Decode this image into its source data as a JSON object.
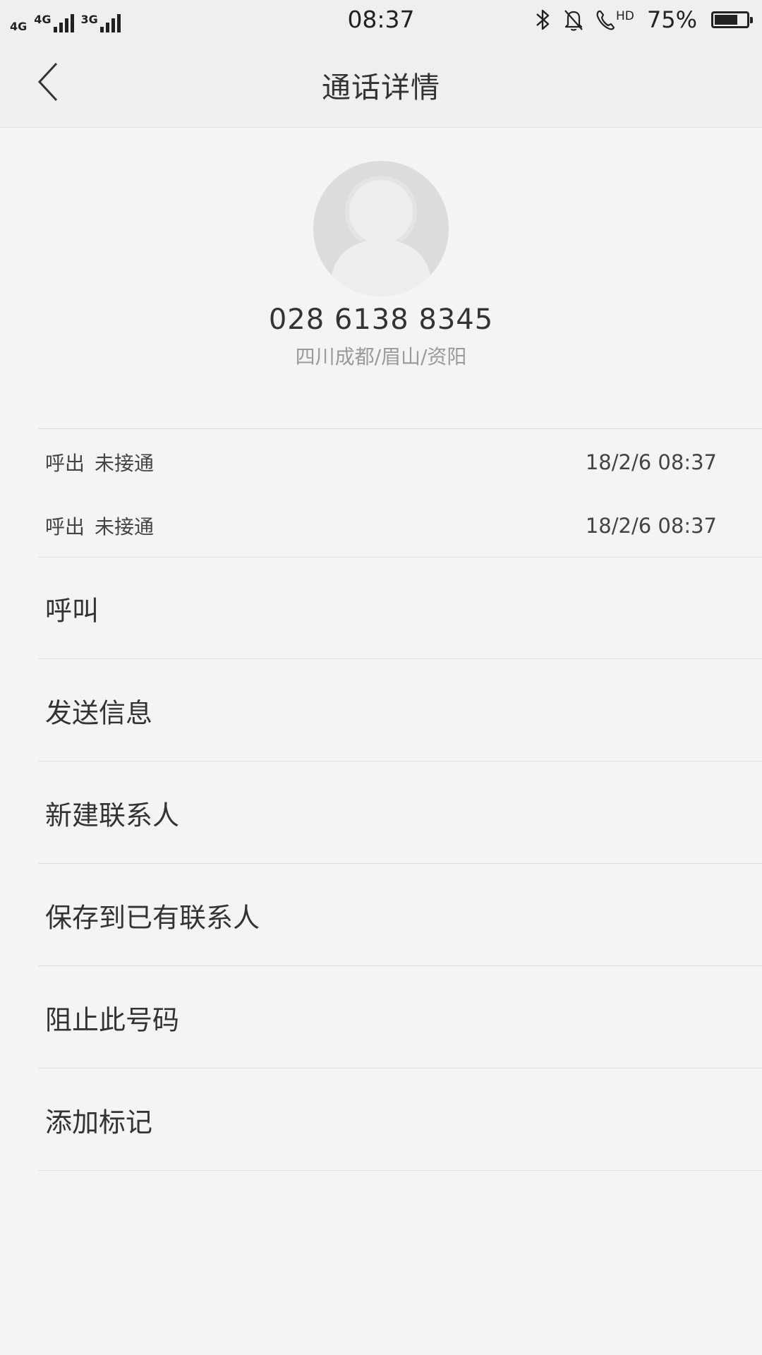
{
  "status_bar": {
    "network1": "4G",
    "network2": "4G",
    "network3": "3G",
    "time": "08:37",
    "hd_label": "HD",
    "battery_text": "75%",
    "battery_level": 0.75
  },
  "header": {
    "title": "通话详情"
  },
  "contact": {
    "phone_number": "028 6138 8345",
    "location": "四川成都/眉山/资阳"
  },
  "call_log": [
    {
      "direction": "呼出",
      "status": "未接通",
      "datetime": "18/2/6 08:37"
    },
    {
      "direction": "呼出",
      "status": "未接通",
      "datetime": "18/2/6 08:37"
    }
  ],
  "actions": [
    {
      "label": "呼叫"
    },
    {
      "label": "发送信息"
    },
    {
      "label": "新建联系人"
    },
    {
      "label": "保存到已有联系人"
    },
    {
      "label": "阻止此号码"
    },
    {
      "label": "添加标记"
    }
  ],
  "colors": {
    "background": "#f4f4f4",
    "header_background": "#efefef",
    "text_primary": "#333333",
    "text_secondary": "#9a9a9a",
    "divider": "#dedede",
    "avatar": "#dcdcdc"
  },
  "icons": [
    "back-arrow-icon",
    "bluetooth-icon",
    "bell-off-icon",
    "hd-call-icon",
    "battery-icon",
    "signal-icon",
    "avatar-placeholder-icon"
  ]
}
